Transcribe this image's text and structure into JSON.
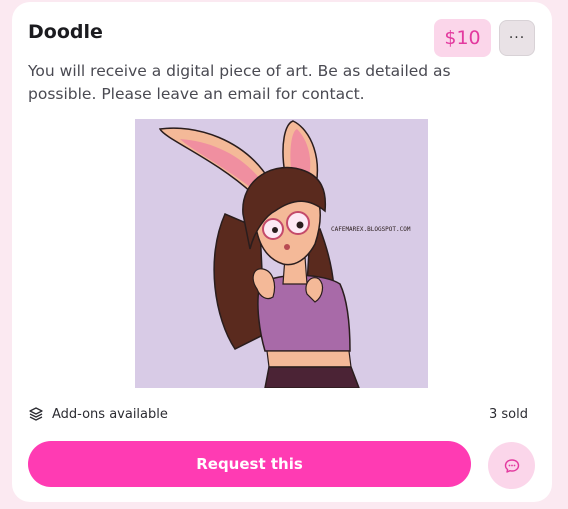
{
  "listing": {
    "title": "Doodle",
    "price": "$10",
    "more_label": "···",
    "description": "You will receive a digital piece of art. Be as detailed as possible. Please leave an email for contact.",
    "artwork_watermark": "CAFEMAREX.BLOGSPOT.COM",
    "addons_label": "Add-ons available",
    "sold_label": "3 sold",
    "request_label": "Request this"
  },
  "icons": {
    "more": "more-icon",
    "addons": "layers-icon",
    "chat": "chat-icon"
  },
  "colors": {
    "accent": "#ff3bb3",
    "price_bg": "#fbd6ea",
    "price_text": "#e33a9f",
    "page_bg": "#fbe9f1"
  }
}
